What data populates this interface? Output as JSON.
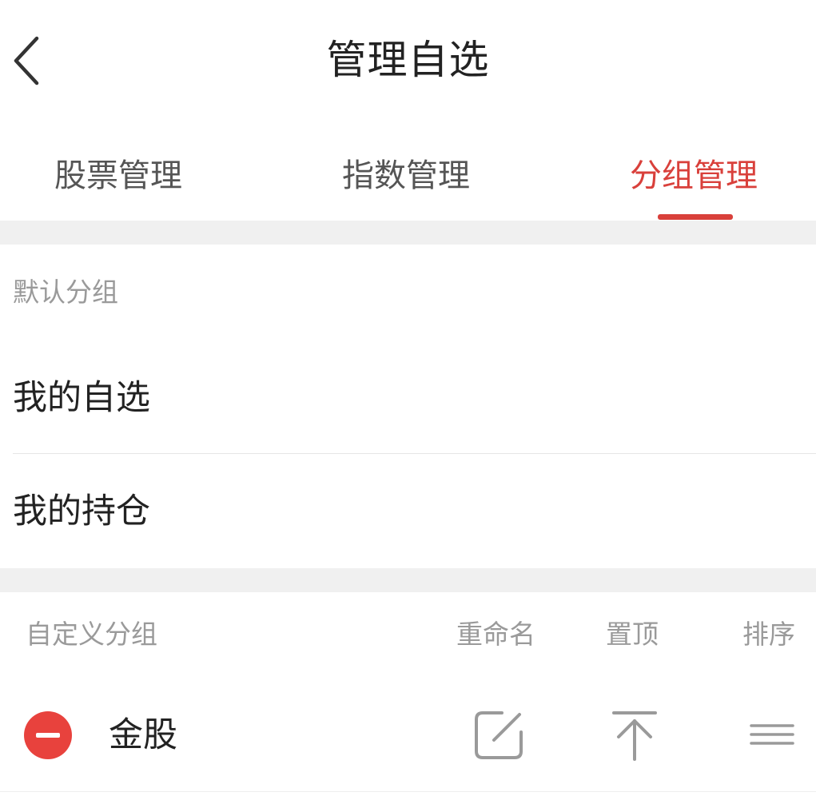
{
  "header": {
    "title": "管理自选",
    "back_icon": "chevron-left-icon"
  },
  "tabs": [
    {
      "label": "股票管理",
      "active": false
    },
    {
      "label": "指数管理",
      "active": false
    },
    {
      "label": "分组管理",
      "active": true
    }
  ],
  "default_groups": {
    "section_label": "默认分组",
    "items": [
      {
        "label": "我的自选"
      },
      {
        "label": "我的持仓"
      }
    ]
  },
  "custom_groups": {
    "section_label": "自定义分组",
    "columns": {
      "rename": "重命名",
      "pin_top": "置顶",
      "sort": "排序"
    },
    "items": [
      {
        "label": "金股",
        "delete_icon": "minus-circle-icon",
        "rename_icon": "edit-icon",
        "pin_icon": "pin-to-top-icon",
        "sort_icon": "drag-handle-icon"
      }
    ]
  },
  "colors": {
    "accent": "#d9403b",
    "delete": "#e8423d",
    "text_primary": "#222222",
    "text_secondary": "#9a9a9a",
    "gap_background": "#f0f0f0"
  }
}
